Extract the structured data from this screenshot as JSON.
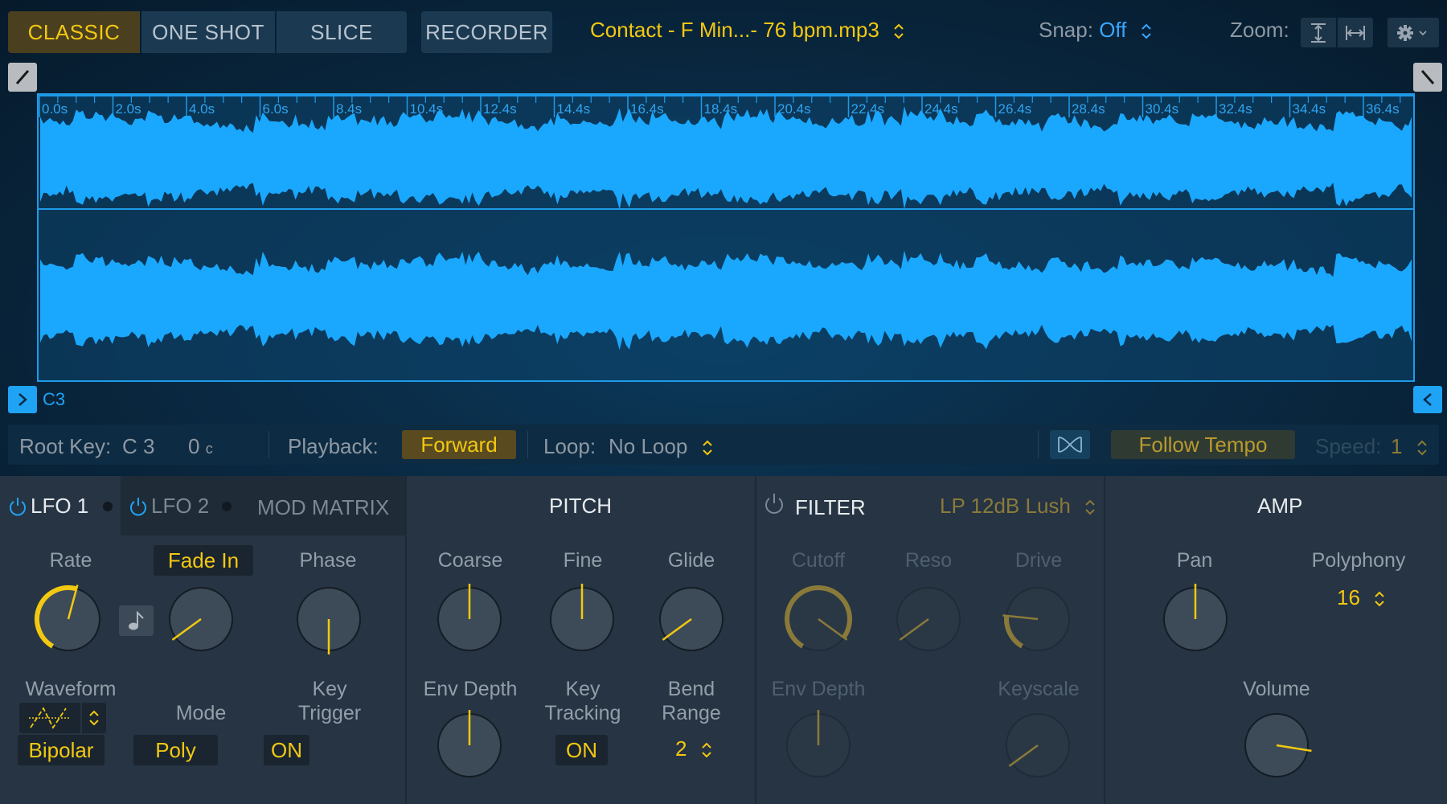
{
  "header": {
    "mode_tabs": [
      {
        "label": "CLASSIC",
        "active": true
      },
      {
        "label": "ONE SHOT",
        "active": false
      },
      {
        "label": "SLICE",
        "active": false
      }
    ],
    "recorder_label": "RECORDER",
    "file_title": "Contact - F Min...-  76 bpm.mp3",
    "snap_label": "Snap:",
    "snap_value": "Off",
    "zoom_label": "Zoom:",
    "icons": {
      "zoom_vertical": "zoom-vertical-icon",
      "zoom_horizontal": "zoom-horizontal-icon",
      "settings": "gear-icon"
    }
  },
  "waveform": {
    "ruler_labels": [
      "0.0s",
      "2.0s",
      "4.0s",
      "6.0s",
      "8.4s",
      "10.4s",
      "12.4s",
      "14.4s",
      "16.4s",
      "18.4s",
      "20.4s",
      "22.4s",
      "24.4s",
      "26.4s",
      "28.4s",
      "30.4s",
      "32.4s",
      "34.4s",
      "36.4s"
    ],
    "channels": 2,
    "root_marker_label": "C3",
    "color": "#1aa8ff"
  },
  "info_bar": {
    "root_key_label": "Root Key:",
    "root_key_value": "C 3",
    "cents_value": "0",
    "cents_unit": "c",
    "playback_label": "Playback:",
    "playback_value": "Forward",
    "loop_label": "Loop:",
    "loop_value": "No Loop",
    "follow_tempo_label": "Follow Tempo",
    "speed_label": "Speed:",
    "speed_value": "1"
  },
  "lfo": {
    "tabs": [
      {
        "label": "LFO 1",
        "active": true
      },
      {
        "label": "LFO 2",
        "active": false
      },
      {
        "label": "MOD MATRIX",
        "active": false
      }
    ],
    "rate_label": "Rate",
    "rate_value": 0.55,
    "fade_in_label": "Fade In",
    "fade_in_value": 0.08,
    "phase_label": "Phase",
    "phase_value": 0.5,
    "waveform_label": "Waveform",
    "waveform_polarity": "Bipolar",
    "mode_label": "Mode",
    "mode_value": "Poly",
    "key_trigger_label_1": "Key",
    "key_trigger_label_2": "Trigger",
    "key_trigger_value": "ON"
  },
  "pitch": {
    "title": "PITCH",
    "coarse_label": "Coarse",
    "coarse_value": 0.5,
    "fine_label": "Fine",
    "fine_value": 0.5,
    "glide_label": "Glide",
    "glide_value": 0.08,
    "env_depth_label": "Env Depth",
    "env_depth_value": 0.5,
    "key_tracking_label_1": "Key",
    "key_tracking_label_2": "Tracking",
    "key_tracking_value": "ON",
    "bend_range_label_1": "Bend",
    "bend_range_label_2": "Range",
    "bend_range_value": "2"
  },
  "filter": {
    "title": "FILTER",
    "enabled": false,
    "type_value": "LP 12dB Lush",
    "cutoff_label": "Cutoff",
    "cutoff_value": 0.92,
    "reso_label": "Reso",
    "reso_value": 0.08,
    "drive_label": "Drive",
    "drive_value": 0.22,
    "env_depth_label": "Env Depth",
    "env_depth_value": 0.5,
    "keyscale_label": "Keyscale",
    "keyscale_value": 0.08
  },
  "amp": {
    "title": "AMP",
    "pan_label": "Pan",
    "pan_value": 0.5,
    "polyphony_label": "Polyphony",
    "polyphony_value": "16",
    "volume_label": "Volume",
    "volume_value": 0.83
  },
  "colors": {
    "accent_yellow": "#f2c811",
    "accent_blue": "#1fa3f5",
    "dim_gold": "#8a7a3a"
  }
}
